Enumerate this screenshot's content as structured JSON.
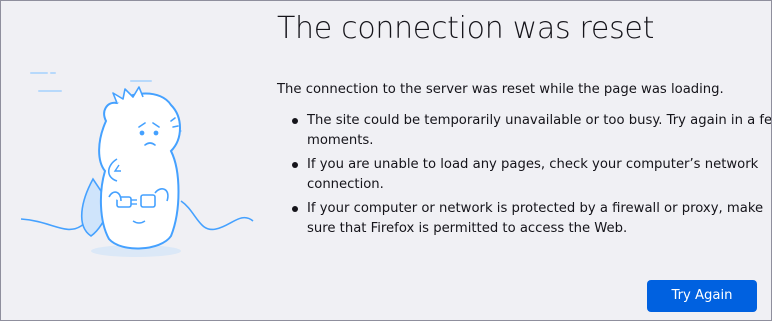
{
  "error_page": {
    "title": "The connection was reset",
    "intro": "The connection to the server was reset while the page was loading.",
    "bullets": [
      "The site could be temporarily unavailable or too busy. Try again in a few moments.",
      "If you are unable to load any pages, check your computer’s network connection.",
      "If your computer or network is protected by a firewall or proxy, make sure that Firefox is permitted to access the Web."
    ],
    "try_again_label": "Try Again",
    "illustration_icon": "dino-unplugged-cable-icon"
  },
  "colors": {
    "page_background": "#f0f0f4",
    "text": "#15141a",
    "accent_button": "#0061e0",
    "illustration_stroke": "#45a1ff",
    "illustration_fill": "#ffffff"
  }
}
